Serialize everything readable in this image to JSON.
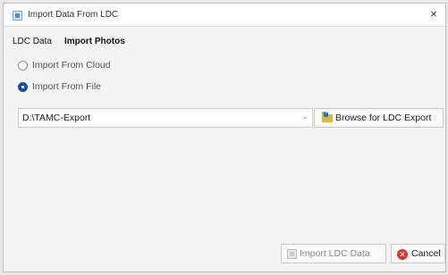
{
  "window": {
    "title": "Import Data From LDC",
    "close_glyph": "×"
  },
  "tabs": [
    {
      "label": "LDC Data",
      "active": true
    },
    {
      "label": "Import Photos",
      "active": false
    }
  ],
  "import_options": [
    {
      "label": "Import From Cloud",
      "selected": false
    },
    {
      "label": "Import From File",
      "selected": true
    }
  ],
  "path": {
    "value": "D:\\TAMC-Export",
    "dropdown_glyph": "⌄"
  },
  "buttons": {
    "browse": {
      "label": "Browse for LDC Export",
      "icon": "folder-icon"
    },
    "import": {
      "label": "Import LDC Data",
      "icon": "import-icon",
      "enabled": false
    },
    "cancel": {
      "label": "Cancel",
      "icon": "cancel-icon"
    }
  },
  "colors": {
    "radio_selected": "#1e4f9c",
    "cancel_icon": "#d9362b",
    "folder_icon": "#e3b43c"
  }
}
